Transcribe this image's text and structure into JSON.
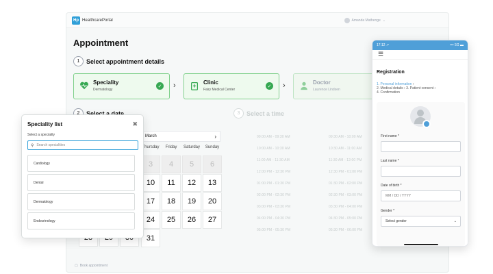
{
  "app": {
    "logo": "Hp",
    "name": "HealthcarePortal",
    "user": "Amanda Mathenge"
  },
  "page_title": "Appointment",
  "step1": {
    "num": "1",
    "label": "Select appointment details"
  },
  "cards": [
    {
      "title": "Speciality",
      "sub": "Dermatology",
      "icon": "heart-pulse-icon"
    },
    {
      "title": "Clinic",
      "sub": "Fairy Medical Center",
      "icon": "clinic-icon"
    },
    {
      "title": "Doctor",
      "sub": "Laurence Lindsen",
      "icon": "doctor-icon"
    }
  ],
  "step2": {
    "num": "2",
    "label": "Select a date"
  },
  "step3": {
    "num": "3",
    "label": "Select a time"
  },
  "calendar": {
    "month": "March",
    "next": "›",
    "dows": [
      "Thursday",
      "Friday",
      "Saturday",
      "Sunday"
    ],
    "rows": [
      [
        "3",
        "4",
        "5",
        "6"
      ],
      [
        "10",
        "11",
        "12",
        "13"
      ],
      [
        "17",
        "18",
        "19",
        "20"
      ],
      [
        "24",
        "25",
        "26",
        "27"
      ],
      [
        "31"
      ]
    ],
    "left_partial": [
      "28",
      "29",
      "30"
    ]
  },
  "times": [
    [
      "09:00 AM - 09:30 AM",
      "09:30 AM - 10:00 AM"
    ],
    [
      "10:00 AM - 10:30 AM",
      "10:30 AM - 11:00 AM"
    ],
    [
      "11:00 AM - 11:30 AM",
      "11:30 AM - 12:00 PM"
    ],
    [
      "12:00 PM - 12:30 PM",
      "12:30 PM - 01:00 PM"
    ],
    [
      "01:00 PM - 01:30 PM",
      "01:30 PM - 02:00 PM"
    ],
    [
      "02:00 PM - 02:30 PM",
      "02:30 PM - 03:00 PM"
    ],
    [
      "03:00 PM - 03:30 PM",
      "03:30 PM - 04:00 PM"
    ],
    [
      "04:00 PM - 04:30 PM",
      "04:30 PM - 05:00 PM"
    ],
    [
      "05:00 PM - 05:30 PM",
      "05:30 PM - 06:00 PM"
    ]
  ],
  "footer": {
    "label": "Book appointment"
  },
  "popup": {
    "title": "Speciality list",
    "close": "✖",
    "label": "Select a speciality",
    "search_placeholder": "Search specialities",
    "items": [
      "Cardiology",
      "Dental",
      "Dermatology",
      "Endocrinology"
    ]
  },
  "phone": {
    "time": "17:12 ↗",
    "signal": "▪▪▪ 5G ▬",
    "menu": "☰",
    "title": "Registration",
    "crumbs": {
      "c1": "1. Personal information",
      "c2": "2. Medical details",
      "c3": "3. Patient consent",
      "c4": "4. Confirmation"
    },
    "fields": [
      {
        "label": "First name *",
        "value": ""
      },
      {
        "label": "Last name *",
        "value": ""
      },
      {
        "label": "Date of birth *",
        "value": "MM / DD / YYYY"
      },
      {
        "label": "Gender *",
        "value": "Select gender"
      }
    ]
  },
  "colors": {
    "accent": "#2f9fd8",
    "success": "#36a852",
    "card_bg": "#eefaee"
  }
}
